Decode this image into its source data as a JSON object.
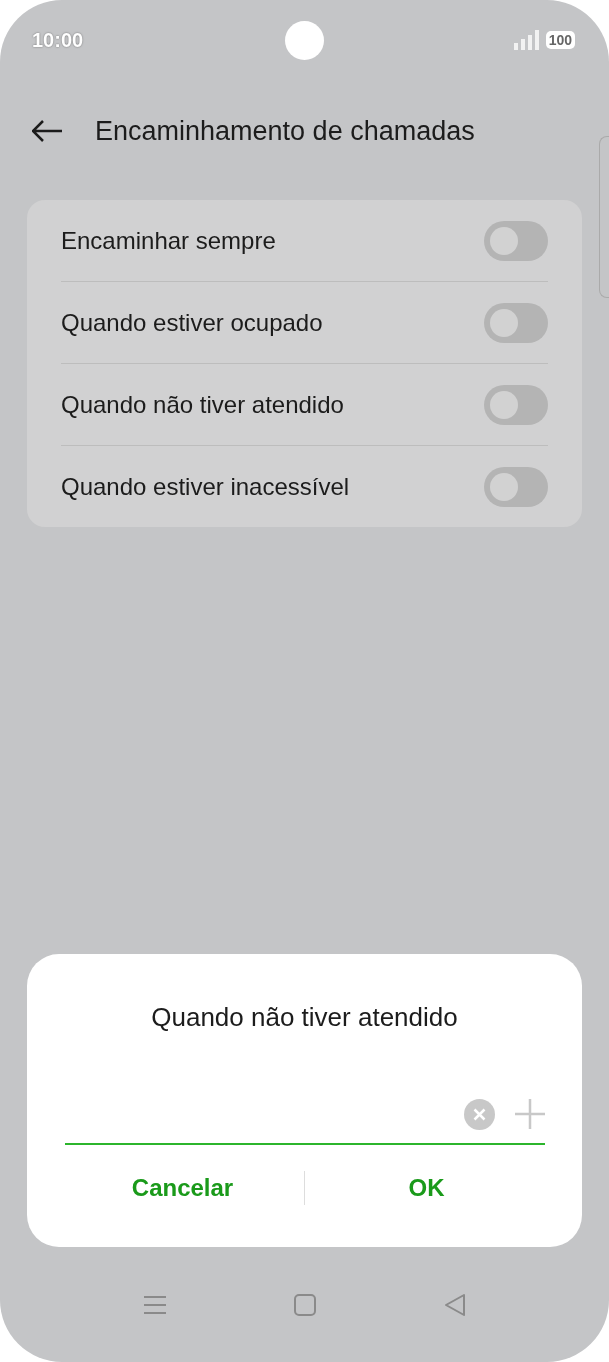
{
  "status_bar": {
    "time": "10:00",
    "battery": "100"
  },
  "header": {
    "title": "Encaminhamento de chamadas"
  },
  "settings": [
    {
      "label": "Encaminhar sempre",
      "on": false
    },
    {
      "label": "Quando estiver ocupado",
      "on": false
    },
    {
      "label": "Quando não tiver atendido",
      "on": false
    },
    {
      "label": "Quando estiver inacessível",
      "on": false
    }
  ],
  "dialog": {
    "title": "Quando não tiver atendido",
    "buttons": [
      "Cancelar",
      "OK"
    ]
  }
}
